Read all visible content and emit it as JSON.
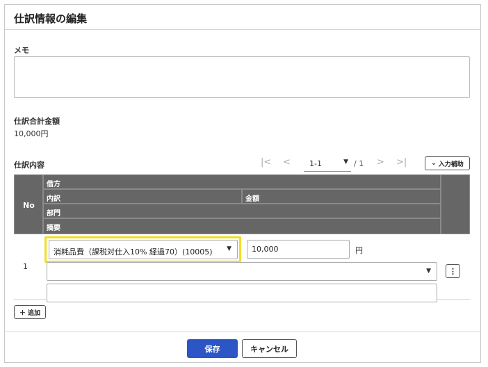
{
  "dialog": {
    "title": "仕訳情報の編集"
  },
  "memo": {
    "label": "メモ",
    "value": ""
  },
  "total": {
    "label": "仕訳合計金額",
    "value": "10,000円"
  },
  "details": {
    "label": "仕訳内容",
    "pager": {
      "first_icon": "first-page-icon",
      "prev_icon": "prev-page-icon",
      "range": "1-1",
      "total": "/ 1",
      "next_icon": "next-page-icon",
      "last_icon": "last-page-icon"
    },
    "assist_button": "入力補助"
  },
  "grid": {
    "headers": {
      "no": "No",
      "debit": "借方",
      "breakdown": "内訳",
      "amount": "金額",
      "department": "部門",
      "summary": "摘要"
    },
    "rows": [
      {
        "no": "1",
        "account": "消耗品費（課税対仕入10% 経過70）(10005)",
        "amount": "10,000",
        "currency": "円",
        "department": "",
        "summary": ""
      }
    ]
  },
  "add_button": "追加",
  "footer": {
    "save": "保存",
    "cancel": "キャンセル"
  },
  "colors": {
    "primary": "#2c56c5",
    "header_bg": "#666666",
    "highlight": "#f2de22"
  }
}
